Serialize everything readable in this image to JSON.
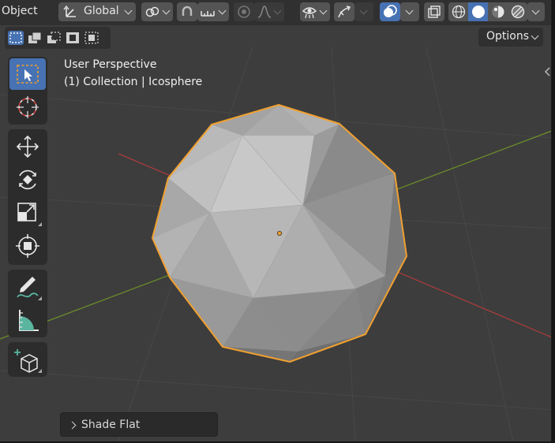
{
  "header": {
    "mode_label": "Object",
    "transform_orientation": "Global"
  },
  "tool_settings": {
    "options_label": "Options"
  },
  "viewport": {
    "view_name": "User Perspective",
    "collection_label": "(1) Collection | Icosphere"
  },
  "last_operator": {
    "label": "Shade Flat"
  },
  "colors": {
    "accent": "#4772b3",
    "selection_outline": "#f0a030",
    "x_axis": "#a83c3c",
    "y_axis": "#6a8c2a"
  }
}
